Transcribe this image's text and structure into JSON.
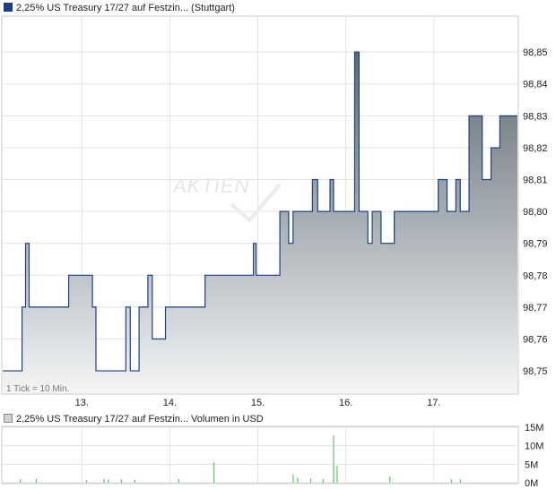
{
  "chart_data": [
    {
      "type": "area",
      "title": "2,25% US Treasury 17/27 auf Festzin... (Stuttgart)",
      "note": "1 Tick = 10 Min.",
      "watermark": "AKTIEN",
      "x_ticks": [
        "13.",
        "14.",
        "15.",
        "16.",
        "17."
      ],
      "y_ticks": [
        "98,75",
        "98,76",
        "98,77",
        "98,78",
        "98,79",
        "98,80",
        "98,81",
        "98,82",
        "98,83",
        "98,84",
        "98,85"
      ],
      "ylim": [
        98.743,
        98.861
      ],
      "xlim": [
        12.1,
        17.95
      ],
      "grid": true,
      "colors": {
        "line": "#1a3e8c",
        "fill_top": "#5f6b74",
        "fill_bottom": "#f4f5f6",
        "grid": "#e2e2e2"
      },
      "series": [
        {
          "x": [
            12.1,
            12.3,
            12.32,
            12.36,
            12.4,
            12.8,
            12.85,
            13.05,
            13.12,
            13.16,
            13.2,
            13.45,
            13.5,
            13.55,
            13.65,
            13.75,
            13.8,
            13.95,
            14.2,
            14.4,
            14.45,
            14.95,
            14.98,
            15.1,
            15.15,
            15.25,
            15.35,
            15.4,
            15.62,
            15.68,
            15.72,
            15.82,
            15.86,
            16.06,
            16.1,
            16.15,
            16.25,
            16.3,
            16.4,
            16.45,
            16.55,
            16.62,
            16.7,
            16.8,
            16.9,
            17.0,
            17.05,
            17.15,
            17.25,
            17.3,
            17.4,
            17.55,
            17.65,
            17.75,
            17.95
          ],
          "y": [
            98.75,
            98.75,
            98.77,
            98.79,
            98.77,
            98.77,
            98.78,
            98.78,
            98.77,
            98.75,
            98.75,
            98.75,
            98.77,
            98.75,
            98.77,
            98.78,
            98.76,
            98.77,
            98.77,
            98.78,
            98.78,
            98.79,
            98.78,
            98.78,
            98.78,
            98.8,
            98.79,
            98.8,
            98.81,
            98.8,
            98.8,
            98.81,
            98.8,
            98.8,
            98.85,
            98.8,
            98.79,
            98.8,
            98.79,
            98.79,
            98.8,
            98.8,
            98.8,
            98.8,
            98.8,
            98.8,
            98.81,
            98.8,
            98.81,
            98.8,
            98.83,
            98.81,
            98.82,
            98.83,
            98.83
          ]
        }
      ]
    },
    {
      "type": "bar",
      "title": "2,25% US Treasury 17/27 auf Festzin... Volumen in USD",
      "y_ticks": [
        "0M",
        "5M",
        "10M",
        "15M"
      ],
      "ylim": [
        0,
        15
      ],
      "xlim": [
        12.1,
        17.95
      ],
      "colors": {
        "bar": "#5bc85b"
      },
      "series": [
        {
          "x": [
            12.3,
            12.48,
            13.05,
            13.25,
            13.3,
            13.45,
            13.6,
            14.1,
            14.5,
            15.4,
            15.45,
            15.6,
            15.74,
            15.86,
            15.9,
            16.5,
            17.2,
            17.3
          ],
          "y": [
            1.0,
            1.1,
            0.7,
            1.0,
            0.9,
            0.9,
            0.8,
            1.0,
            5.5,
            2.2,
            1.3,
            1.2,
            1.0,
            12.8,
            4.5,
            1.7,
            0.9,
            1.0
          ]
        }
      ]
    }
  ]
}
